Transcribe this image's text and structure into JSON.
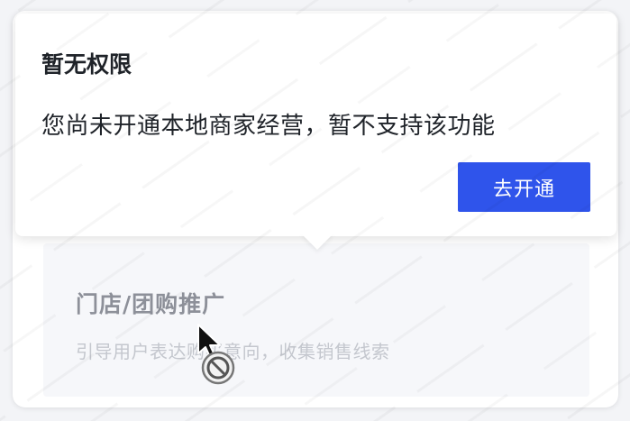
{
  "popover": {
    "title": "暂无权限",
    "message": "您尚未开通本地商家经营，暂不支持该功能",
    "button_label": "去开通",
    "accent_color": "#2f54eb"
  },
  "option": {
    "title": "门店/团购推广",
    "description": "引导用户表达购买意向，收集销售线索",
    "state": "disabled"
  },
  "cursor": {
    "icon": "not-allowed-cursor-icon"
  }
}
